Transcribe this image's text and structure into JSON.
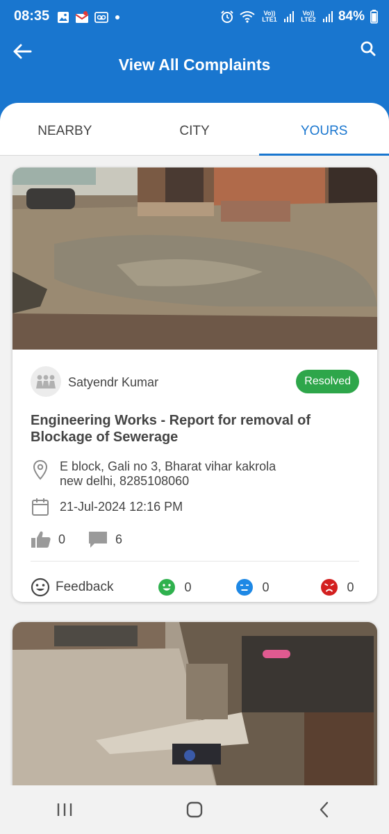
{
  "status_bar": {
    "time": "08:35",
    "battery": "84%",
    "sim1_label": "Vo)) LTE1",
    "sim2_label": "Vo)) LTE2",
    "icons": [
      "image-icon",
      "mail-icon",
      "voicemail-icon",
      "dot-icon",
      "alarm-icon",
      "wifi-icon",
      "signal-icon",
      "battery-icon"
    ]
  },
  "header": {
    "title": "View All Complaints",
    "color": "#1976cf"
  },
  "tabs": [
    {
      "label": "NEARBY",
      "active": false
    },
    {
      "label": "CITY",
      "active": false
    },
    {
      "label": "YOURS",
      "active": true
    }
  ],
  "complaints": [
    {
      "user": "Satyendr Kumar",
      "status": "Resolved",
      "status_color": "#2ea64a",
      "title": "Engineering Works - Report for removal of Blockage of Sewerage",
      "address_line1": "E block, Gali no 3, Bharat vihar kakrola",
      "address_line2": "new delhi, 8285108060",
      "date": "21-Jul-2024 12:16 PM",
      "likes": "0",
      "comments": "6",
      "feedback_label": "Feedback",
      "feedback": {
        "happy": "0",
        "neutral": "0",
        "angry": "0"
      }
    }
  ],
  "navbar": [
    "recent-apps-icon",
    "home-icon",
    "back-icon"
  ]
}
